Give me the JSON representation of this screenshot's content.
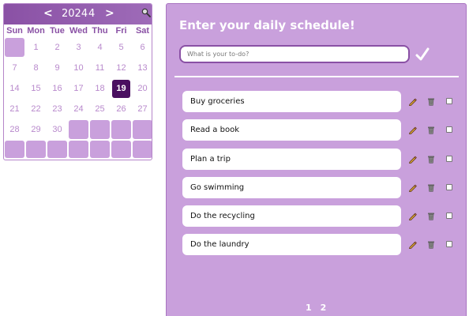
{
  "calendar": {
    "prev_label": "<",
    "next_label": ">",
    "year": "2024",
    "month": "4",
    "search_icon": "magnifier-icon",
    "weekdays": [
      "Sun",
      "Mon",
      "Tue",
      "Wed",
      "Thu",
      "Fri",
      "Sat"
    ],
    "days": [
      "1",
      "2",
      "3",
      "4",
      "5",
      "6",
      "7",
      "8",
      "9",
      "10",
      "11",
      "12",
      "13",
      "14",
      "15",
      "16",
      "17",
      "18",
      "19",
      "20",
      "21",
      "22",
      "23",
      "24",
      "25",
      "26",
      "27",
      "28",
      "29",
      "30"
    ],
    "today": "19",
    "accent_color": "#4a1060"
  },
  "todo": {
    "title": "Enter your daily schedule!",
    "input_placeholder": "What is your to-do?",
    "input_value": "",
    "submit_icon": "checkmark-icon",
    "items": [
      {
        "text": "Buy groceries",
        "done": false
      },
      {
        "text": "Read a book",
        "done": false
      },
      {
        "text": "Plan a trip",
        "done": false
      },
      {
        "text": "Go swimming",
        "done": false
      },
      {
        "text": "Do the recycling",
        "done": false
      },
      {
        "text": "Do the laundry",
        "done": false
      }
    ],
    "pages": [
      "1",
      "2"
    ]
  },
  "colors": {
    "panel_bg": "#c9a0dc",
    "header_purple": "#8a51a5",
    "day_text": "#b889cc"
  }
}
